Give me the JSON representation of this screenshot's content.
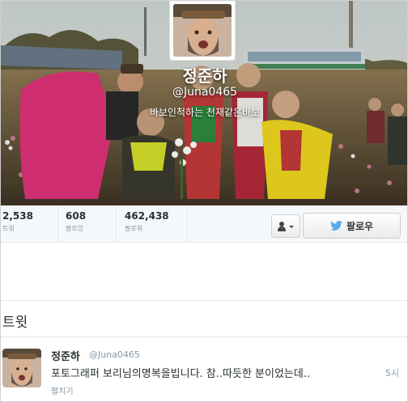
{
  "profile": {
    "name": "정준하",
    "handle": "@Juna0465",
    "bio": "바보인척하는 천재같은바보"
  },
  "stats": [
    {
      "value": "2,538",
      "label": "트윗"
    },
    {
      "value": "608",
      "label": "팔로잉"
    },
    {
      "value": "462,438",
      "label": "팔로워"
    }
  ],
  "actions": {
    "follow_label": "팔로우"
  },
  "tweets_section": {
    "title": "트윗"
  },
  "tweet": {
    "name": "정준하",
    "handle": "@Juna0465",
    "time": "5시",
    "text": "포토그래퍼 보리님의명복을빕니다. 참..따듯한 분이었는데..",
    "expand_label": "펼치기"
  },
  "colors": {
    "accent_blue": "#55acee",
    "text_dark": "#292f33",
    "text_muted": "#8899a6",
    "border": "#e1e8ed"
  },
  "icons": {
    "user_dropdown": "user-icon",
    "follow": "twitter-bird-icon"
  }
}
